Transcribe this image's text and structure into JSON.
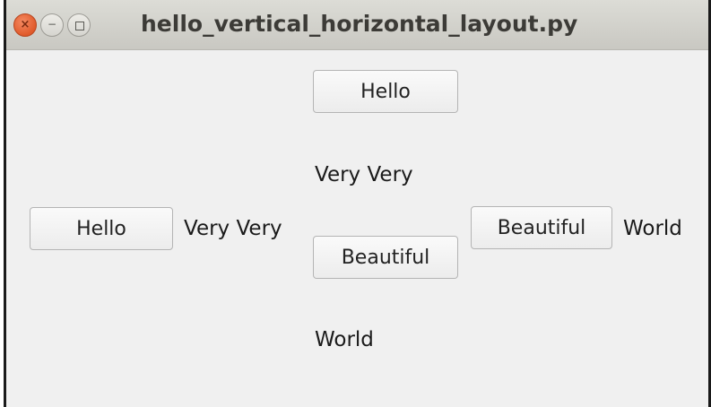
{
  "window": {
    "title": "hello_vertical_horizontal_layout.py",
    "controls": {
      "close_glyph": "×",
      "minimize_glyph": "−"
    }
  },
  "horizontal_layout_left": {
    "hello_button": "Hello",
    "very_very_label": "Very Very"
  },
  "vertical_layout": {
    "hello_button": "Hello",
    "very_very_label": "Very Very",
    "beautiful_button": "Beautiful",
    "world_label": "World"
  },
  "horizontal_layout_right": {
    "beautiful_button": "Beautiful",
    "world_label": "World"
  }
}
